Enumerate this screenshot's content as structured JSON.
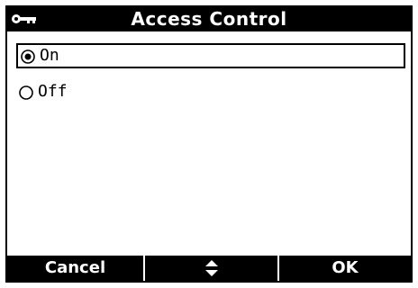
{
  "header": {
    "title": "Access Control",
    "icon": "key-icon"
  },
  "options": [
    {
      "label": "On",
      "selected": true
    },
    {
      "label": "Off",
      "selected": false
    }
  ],
  "softkeys": {
    "left": "Cancel",
    "middle_icon": "up-down-arrows-icon",
    "right": "OK"
  }
}
